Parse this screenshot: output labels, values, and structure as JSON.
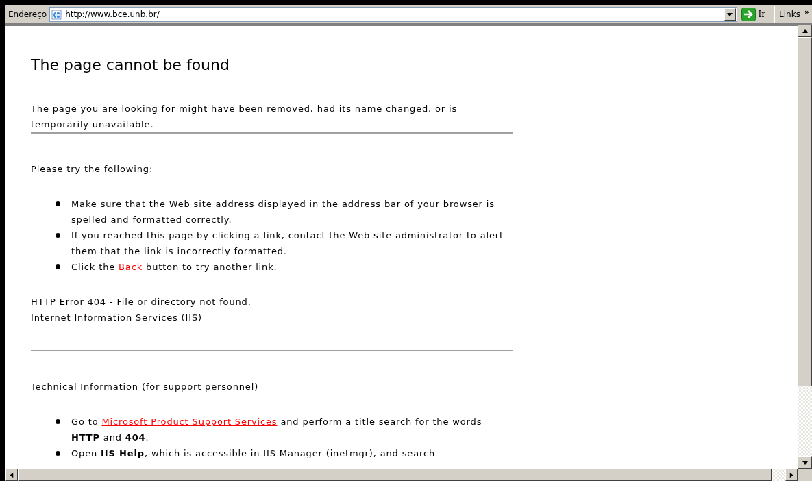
{
  "address_bar": {
    "label": "Endereço",
    "url": "http://www.bce.unb.br/",
    "go_button": "Ir",
    "links": "Links",
    "more": "»"
  },
  "page": {
    "blocks": [
      {
        "kind": "heading",
        "text": "The page cannot be found"
      },
      {
        "kind": "paragraph",
        "parts": [
          {
            "kind": "text",
            "text": "The page you are looking for might have been removed, had its name changed, or is temporarily unavailable."
          }
        ]
      },
      {
        "kind": "rule"
      },
      {
        "kind": "paragraph",
        "parts": [
          {
            "kind": "text",
            "text": "Please try the following:"
          }
        ]
      },
      {
        "kind": "list",
        "items": [
          [
            {
              "kind": "text",
              "text": "Make sure that the Web site address displayed in the address bar of your browser is spelled and formatted correctly."
            }
          ],
          [
            {
              "kind": "text",
              "text": "If you reached this page by clicking a link, contact the Web site administrator to alert them that the link is incorrectly formatted."
            }
          ],
          [
            {
              "kind": "text",
              "text": "Click the "
            },
            {
              "kind": "link",
              "text": "Back"
            },
            {
              "kind": "text",
              "text": " button to try another link."
            }
          ]
        ]
      },
      {
        "kind": "lines",
        "lines": [
          "HTTP Error 404 - File or directory not found.",
          "Internet Information Services (IIS)"
        ]
      },
      {
        "kind": "rule"
      },
      {
        "kind": "paragraph",
        "parts": [
          {
            "kind": "text",
            "text": "Technical Information (for support personnel)"
          }
        ]
      },
      {
        "kind": "list",
        "items": [
          [
            {
              "kind": "text",
              "text": "Go to "
            },
            {
              "kind": "link",
              "text": "Microsoft Product Support Services"
            },
            {
              "kind": "text",
              "text": " and perform a title search for the words **HTTP** and **404**."
            }
          ],
          [
            {
              "kind": "text",
              "text": "Open **IIS Help**, which is accessible in IIS Manager (inetmgr), and search"
            }
          ]
        ]
      }
    ]
  }
}
